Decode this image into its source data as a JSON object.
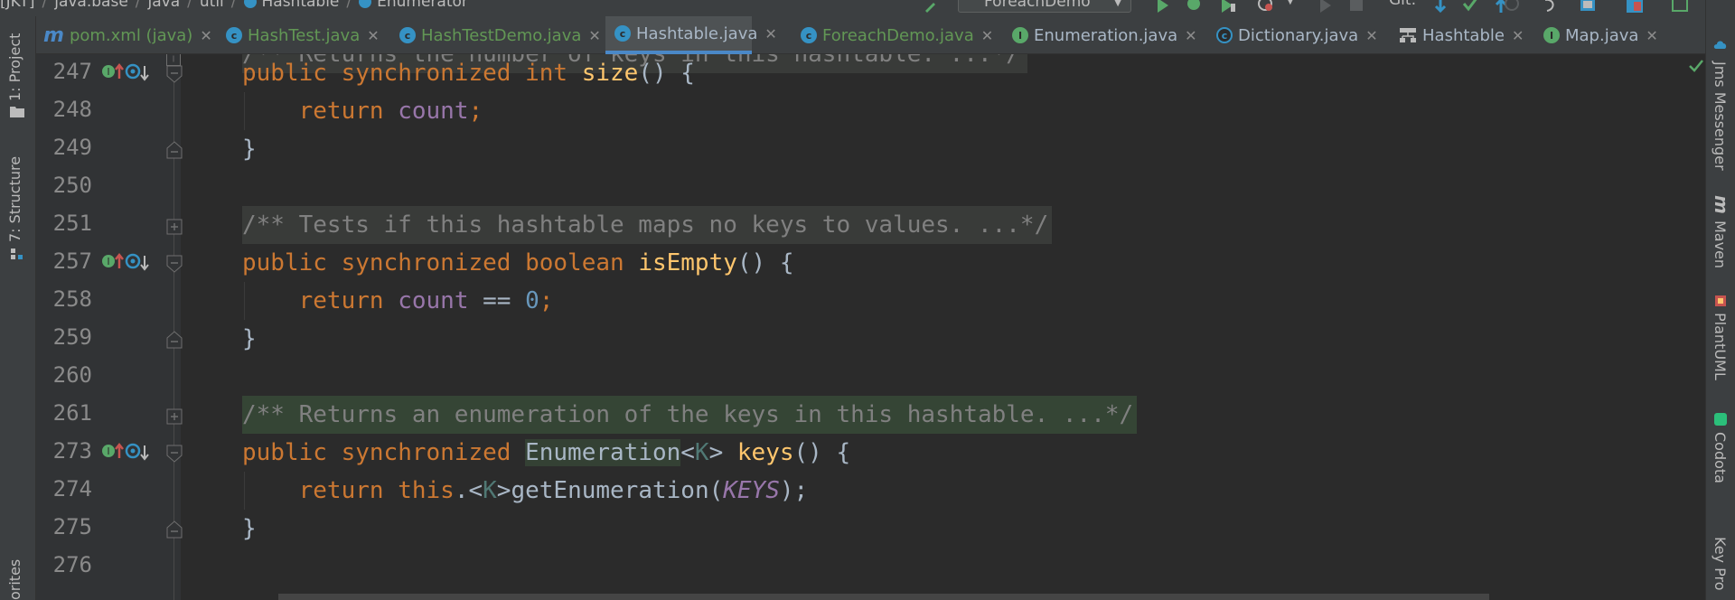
{
  "navbar": {
    "breadcrumb": [
      "[JKT]",
      "java.base",
      "java",
      "util",
      "Hashtable",
      "Enumerator"
    ],
    "run_config": "ForeachDemo",
    "git_label": "Git:"
  },
  "tabs": [
    {
      "label": "pom.xml (java)",
      "icon": "maven-icon",
      "active": false,
      "modified": true
    },
    {
      "label": "HashTest.java",
      "icon": "class-icon",
      "active": false,
      "modified": true
    },
    {
      "label": "HashTestDemo.java",
      "icon": "class-icon",
      "active": false,
      "modified": true
    },
    {
      "label": "Hashtable.java",
      "icon": "class-icon",
      "active": true,
      "modified": false
    },
    {
      "label": "ForeachDemo.java",
      "icon": "class-icon",
      "active": false,
      "modified": true
    },
    {
      "label": "Enumeration.java",
      "icon": "interface-icon",
      "active": false,
      "modified": false
    },
    {
      "label": "Dictionary.java",
      "icon": "abstract-class-icon",
      "active": false,
      "modified": false
    },
    {
      "label": "Hashtable",
      "icon": "diagram-icon",
      "active": false,
      "modified": false
    },
    {
      "label": "Map.java",
      "icon": "interface-icon",
      "active": false,
      "modified": false
    }
  ],
  "left_tools": [
    "1: Project",
    "7: Structure",
    "orites"
  ],
  "right_tools": [
    "Jms Messenger",
    "Maven",
    "PlantUML",
    "Codota",
    "Key Pro"
  ],
  "editor": {
    "line_numbers": [
      "247",
      "248",
      "249",
      "250",
      "251",
      "257",
      "258",
      "259",
      "260",
      "261",
      "273",
      "274",
      "275",
      "276"
    ],
    "top_partial_line": "/** Returns the number of keys in this hashtable. ...*/",
    "code": {
      "l247": [
        "public",
        "synchronized",
        "int",
        "size",
        "() {"
      ],
      "l248": [
        "return",
        "count",
        ";"
      ],
      "l249": "}",
      "l251": "/** Tests if this hashtable maps no keys to values. ...*/",
      "l257": [
        "public",
        "synchronized",
        "boolean",
        "isEmpty",
        "() {"
      ],
      "l258": [
        "return",
        "count",
        " == ",
        "0",
        ";"
      ],
      "l259": "}",
      "l261": "/** Returns an enumeration of the keys in this hashtable. ...*/",
      "l273": [
        "public",
        "synchronized",
        "Enumeration",
        "<",
        "K",
        ">",
        "keys",
        "() {"
      ],
      "l274": [
        "return",
        "this",
        ".<",
        "K",
        ">getEnumeration(",
        "KEYS",
        ");"
      ],
      "l275": "}"
    }
  },
  "colors": {
    "background": "#2b2b2b",
    "keyword": "#cc7832",
    "method": "#ffc66d",
    "field": "#9876aa",
    "number": "#6897bb",
    "comment": "#808080",
    "active_tab_underline": "#4a88c7"
  }
}
